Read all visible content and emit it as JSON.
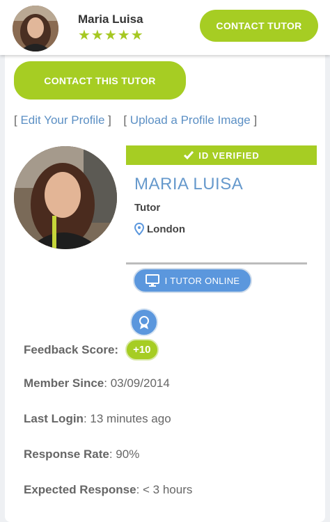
{
  "header": {
    "name": "Maria Luisa",
    "stars": "★★★★★",
    "contact_button": "CONTACT TUTOR"
  },
  "main": {
    "contact_button": "CONTACT THIS TUTOR",
    "edit_profile_link": "Edit Your Profile",
    "upload_image_link": "Upload a Profile Image",
    "id_verified": "ID VERIFIED",
    "tutor_name": "MARIA LUISA",
    "role": "Tutor",
    "location": "London",
    "online_badge": "I TUTOR ONLINE",
    "stats": {
      "feedback_label": "Feedback Score",
      "feedback_value": "+10",
      "member_label": "Member Since",
      "member_value": "03/09/2014",
      "login_label": "Last Login",
      "login_value": "13 minutes ago",
      "response_rate_label": "Response Rate",
      "response_rate_value": "90%",
      "expected_label": "Expected Response",
      "expected_value": "< 3 hours"
    }
  },
  "colors": {
    "accent_green": "#a6cd23",
    "link_blue": "#5b8fc4",
    "badge_blue": "#5b97dd"
  },
  "icons": [
    "star-icon",
    "check-icon",
    "location-pin-icon",
    "monitor-icon",
    "award-icon"
  ]
}
